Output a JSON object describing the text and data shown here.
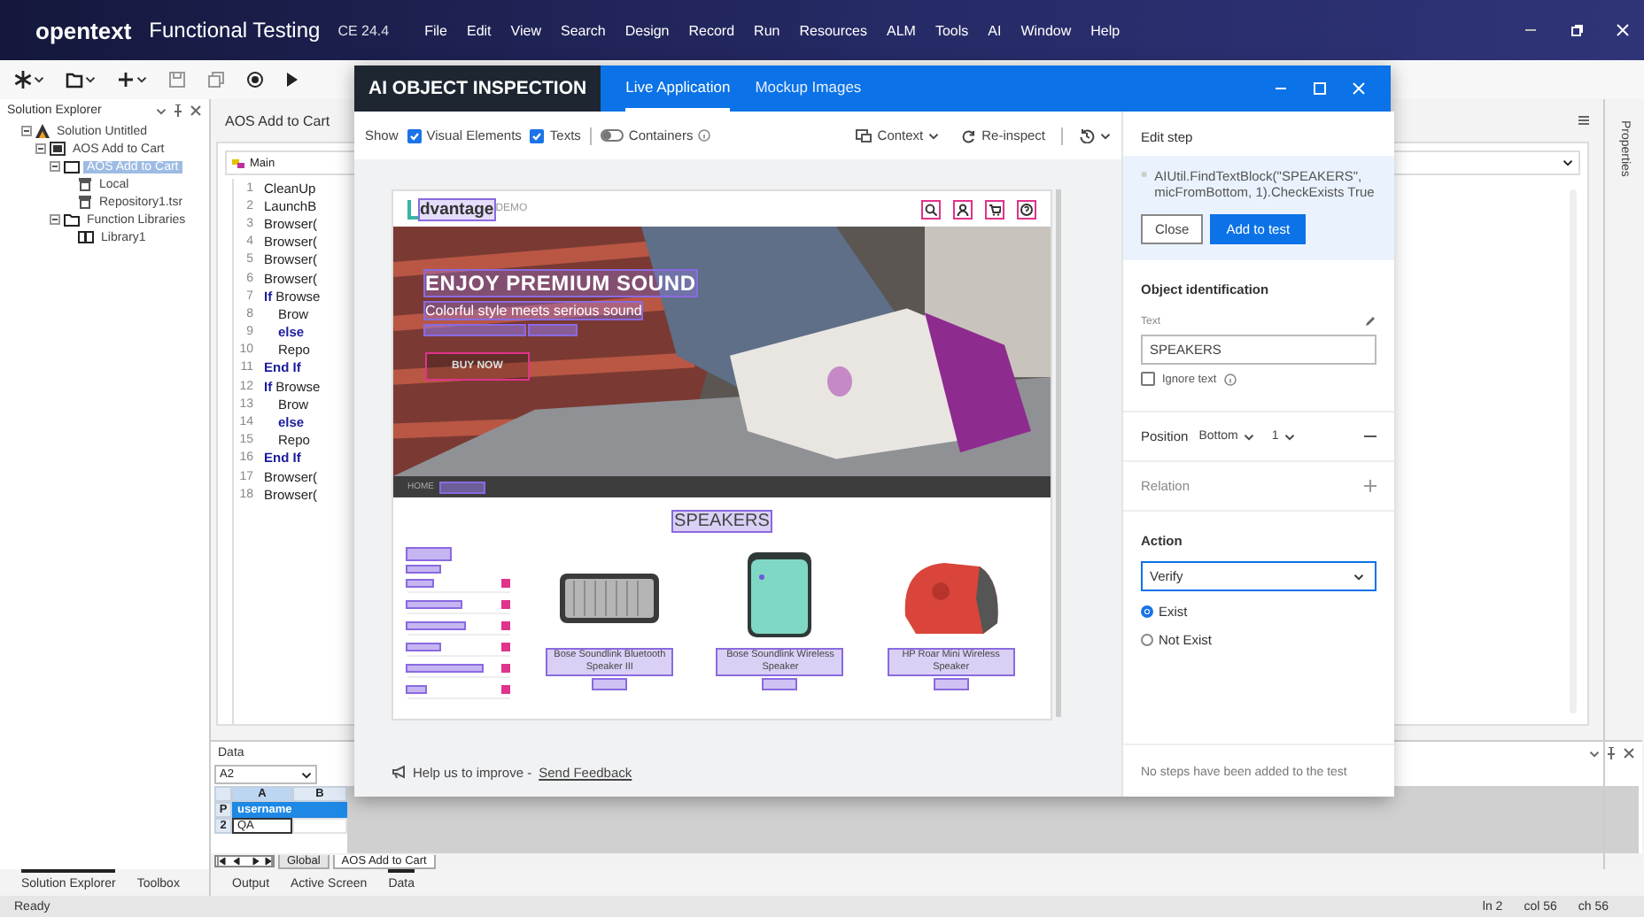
{
  "app": {
    "brand": "opentext",
    "product": "Functional Testing",
    "edition": "CE 24.4",
    "menu": [
      "File",
      "Edit",
      "View",
      "Search",
      "Design",
      "Record",
      "Run",
      "Resources",
      "ALM",
      "Tools",
      "AI",
      "Window",
      "Help"
    ]
  },
  "solution_explorer": {
    "title": "Solution Explorer",
    "tree": [
      {
        "label": "Solution Untitled",
        "kind": "solution",
        "expanded": true,
        "selected": false,
        "children": [
          {
            "label": "AOS Add to Cart",
            "kind": "test",
            "expanded": true,
            "selected": false,
            "children": [
              {
                "label": "AOS Add to Cart",
                "kind": "action",
                "expanded": true,
                "selected": true,
                "children": [
                  {
                    "label": "Local",
                    "kind": "repository",
                    "selected": false
                  },
                  {
                    "label": "Repository1.tsr",
                    "kind": "repository",
                    "selected": false
                  }
                ]
              },
              {
                "label": "Function Libraries",
                "kind": "folder",
                "expanded": true,
                "selected": false,
                "children": [
                  {
                    "label": "Library1",
                    "kind": "library",
                    "selected": false
                  }
                ]
              }
            ]
          }
        ]
      }
    ]
  },
  "document": {
    "tab": "AOS Add to Cart",
    "action": "Main",
    "lines": [
      {
        "number": "1",
        "code": "CleanUp"
      },
      {
        "number": "2",
        "code": "LaunchB"
      },
      {
        "number": "3",
        "code": "Browser("
      },
      {
        "number": "4",
        "code": "Browser("
      },
      {
        "number": "5",
        "code": "Browser("
      },
      {
        "number": "6",
        "code": "Browser("
      },
      {
        "number": "7",
        "code": "**If** Browse",
        "children": [
          {
            "number": "8",
            "code": "Brow"
          },
          {
            "number": "9",
            "code": "**else**"
          },
          {
            "number": "10",
            "code": "Repo"
          }
        ]
      },
      {
        "number": "11",
        "code": "**End If**"
      },
      {
        "number": "12",
        "code": "**If** Browse",
        "children": [
          {
            "number": "13",
            "code": "Brow"
          },
          {
            "number": "14",
            "code": "**else**"
          },
          {
            "number": "15",
            "code": "Repo"
          }
        ]
      },
      {
        "number": "16",
        "code": "**End If**"
      },
      {
        "number": "17",
        "code": "Browser("
      },
      {
        "number": "18",
        "code": "Browser("
      }
    ]
  },
  "data_panel": {
    "title": "Data",
    "cell_ref": "A2",
    "columns": [
      "A",
      "B"
    ],
    "rows": [
      {
        "header": "P",
        "value": "username",
        "kind": "parameter",
        "selected": false
      },
      {
        "header": "2",
        "value": "QA",
        "kind": "value",
        "selected": true
      }
    ],
    "sheets": [
      {
        "label": "Global",
        "selected": false
      },
      {
        "label": "AOS Add to Cart",
        "selected": true
      }
    ]
  },
  "bottom_tabs_left": [
    {
      "label": "Solution Explorer",
      "selected": true
    },
    {
      "label": "Toolbox",
      "selected": false
    }
  ],
  "bottom_tabs": [
    {
      "label": "Output",
      "selected": false
    },
    {
      "label": "Active Screen",
      "selected": false
    },
    {
      "label": "Data",
      "selected": true
    }
  ],
  "properties_tab": "Properties",
  "status_bar": {
    "text": "Ready",
    "ln": "ln 2",
    "col": "col 56",
    "ch": "ch 56"
  },
  "inspection": {
    "title": "AI OBJECT INSPECTION",
    "tabs": [
      {
        "label": "Live Application",
        "selected": true
      },
      {
        "label": "Mockup Images",
        "selected": false
      }
    ],
    "show_label": "Show",
    "options": [
      {
        "label": "Visual Elements",
        "kind": "checkbox",
        "checked": true
      },
      {
        "label": "Texts",
        "kind": "checkbox",
        "checked": true
      },
      {
        "label": "Containers",
        "kind": "toggle",
        "checked": false
      }
    ],
    "context": "Context",
    "reinspect": "Re-inspect",
    "page": {
      "logo_main": "dvantage",
      "logo_sub": "DEMO",
      "hero_title": "ENJOY PREMIUM SOUND",
      "hero_subtitle": "Colorful style meets serious sound",
      "hero_button": "BUY NOW",
      "breadcrumb": "HOME",
      "category": "SPEAKERS",
      "products": [
        {
          "name": "Bose Soundlink Bluetooth Speaker III",
          "kind": "bar"
        },
        {
          "name": "Bose Soundlink Wireless Speaker",
          "kind": "cube"
        },
        {
          "name": "HP Roar Mini Wireless Speaker",
          "kind": "round"
        }
      ]
    },
    "feedback": {
      "text": "Help us to improve - ",
      "link": "Send Feedback"
    }
  },
  "edit_step": {
    "title": "Edit step",
    "statement": "AIUtil.FindTextBlock(\"SPEAKERS\", micFromBottom, 1).CheckExists True",
    "close": "Close",
    "add": "Add to test",
    "object_heading": "Object identification",
    "text_label": "Text",
    "text_value": "SPEAKERS",
    "ignore_text": {
      "label": "Ignore text",
      "checked": false
    },
    "position": {
      "label": "Position",
      "anchor": "Bottom",
      "index": "1"
    },
    "relation": "Relation",
    "action_heading": "Action",
    "action_value": "Verify",
    "options": [
      {
        "label": "Exist",
        "selected": true
      },
      {
        "label": "Not Exist",
        "selected": false
      }
    ],
    "footer": "No steps have been added to the test"
  }
}
